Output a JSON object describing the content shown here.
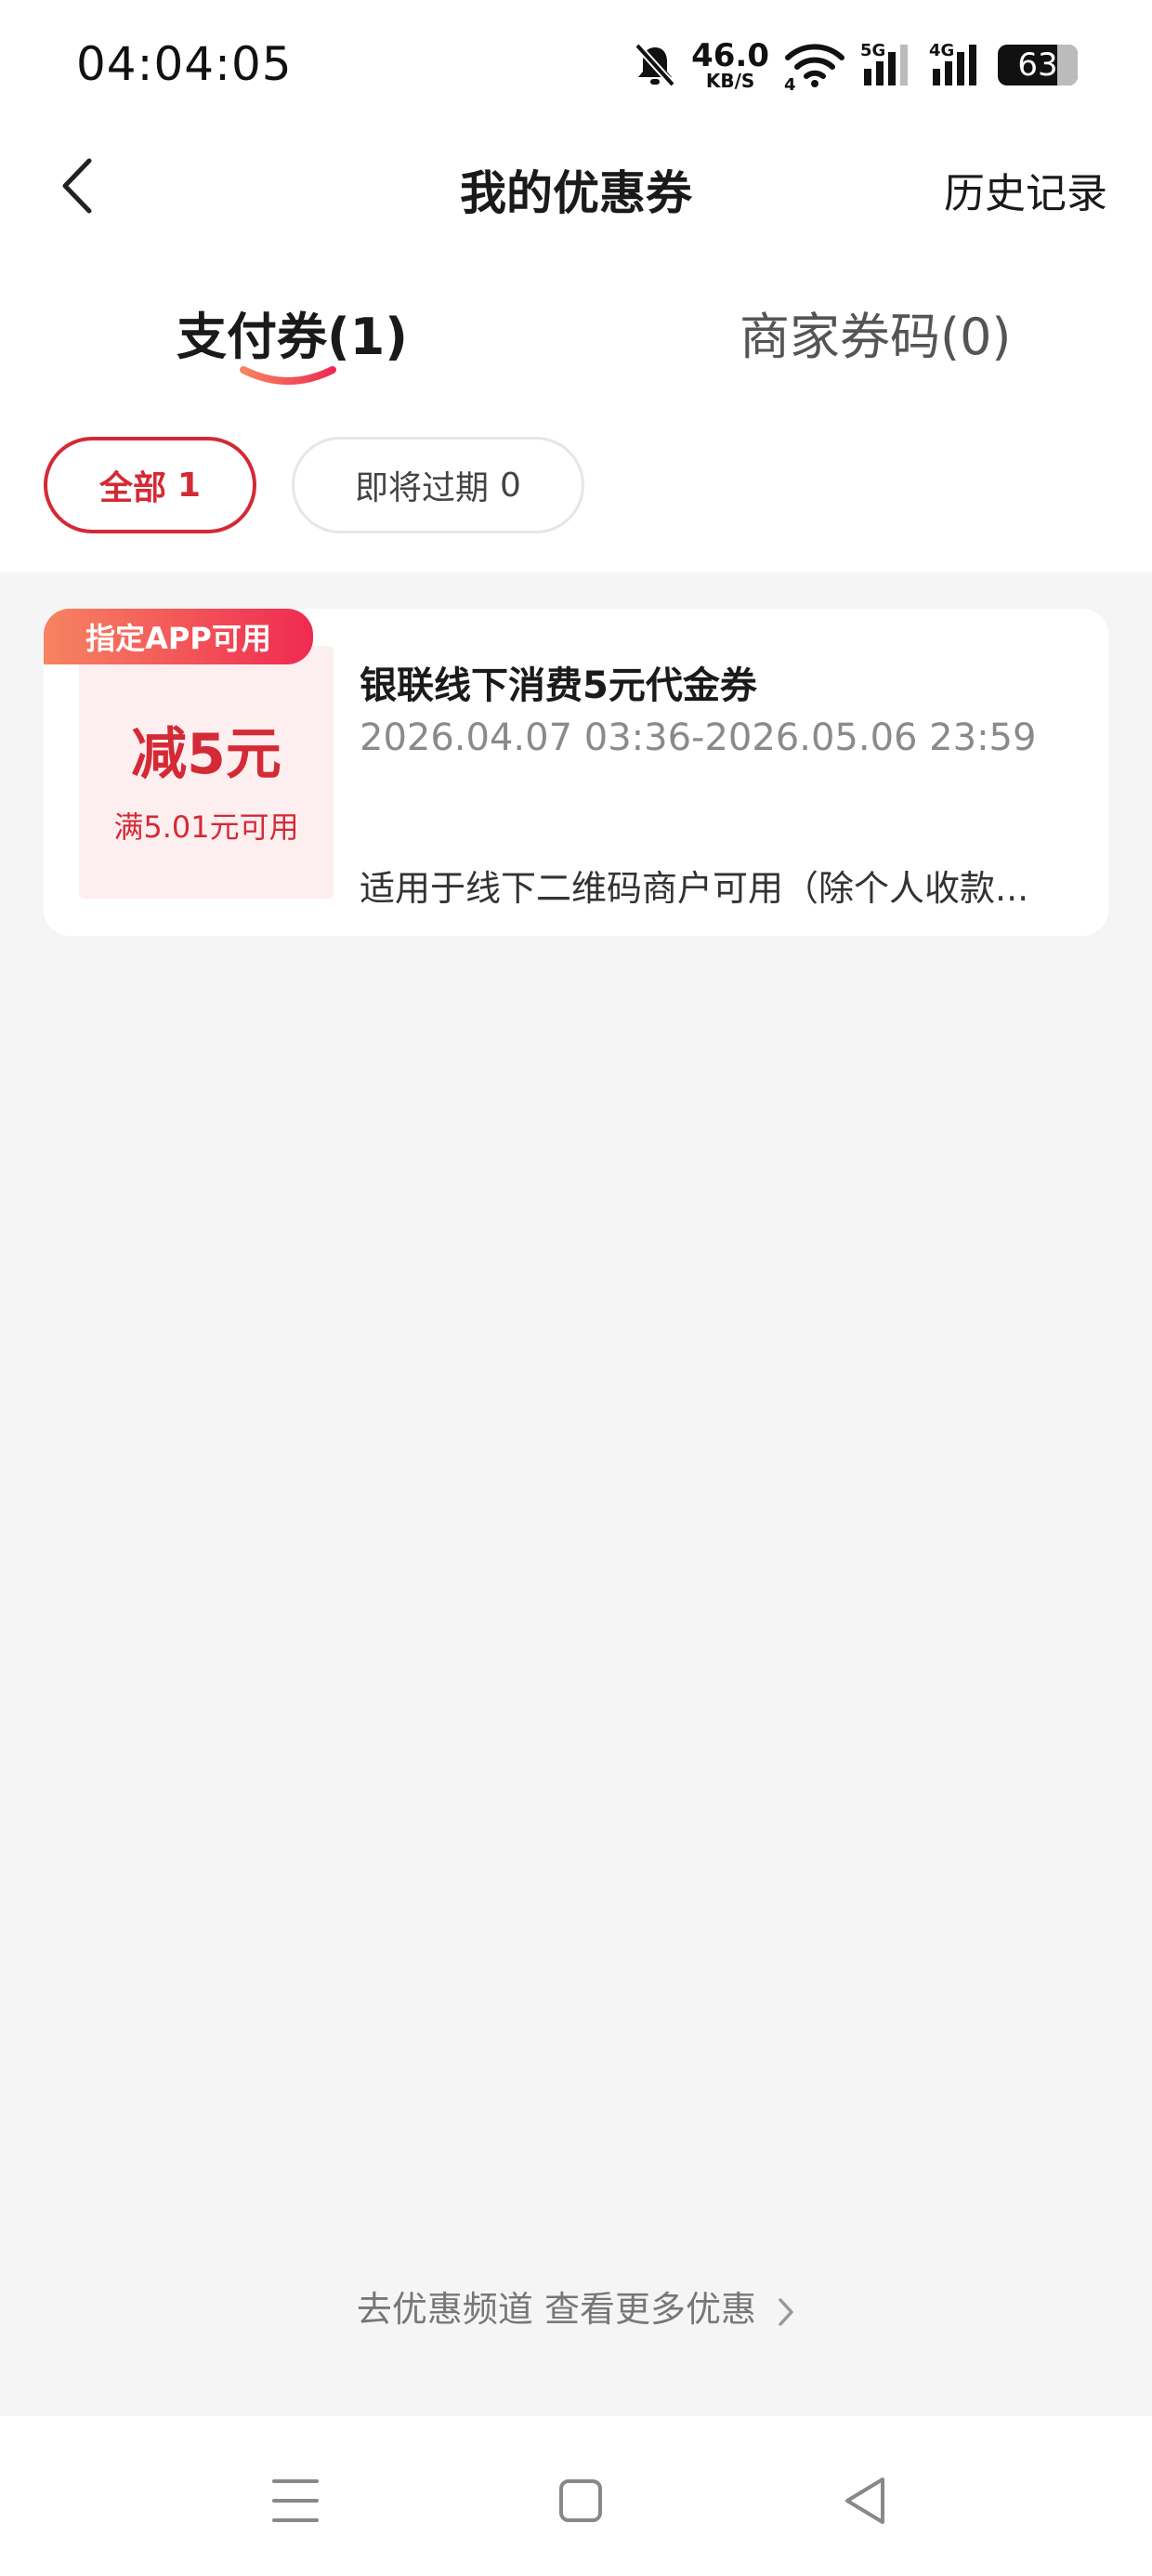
{
  "status_bar": {
    "time": "04:04:05",
    "net_speed_value": "46.0",
    "net_speed_unit": "KB/S",
    "wifi_sub": "4",
    "signal_1_label": "5G",
    "signal_2_label": "4G",
    "battery": "63",
    "icons": [
      "mute-bell-icon",
      "wifi-icon",
      "signal-5g-icon",
      "signal-4g-icon",
      "battery-icon"
    ]
  },
  "header": {
    "title": "我的优惠券",
    "history_label": "历史记录",
    "back_icon": "chevron-left-icon"
  },
  "tabs": [
    {
      "label": "支付券(1)",
      "active": true
    },
    {
      "label": "商家券码(0)",
      "active": false
    }
  ],
  "filters": [
    {
      "label": "全部",
      "count": "1",
      "active": true
    },
    {
      "label": "即将过期",
      "count": "0",
      "active": false
    }
  ],
  "coupons": [
    {
      "tag": "指定APP可用",
      "amount": "减5元",
      "condition": "满5.01元可用",
      "name": "银联线下消费5元代金券",
      "validity": "2026.04.07 03:36-2026.05.06 23:59",
      "description": "适用于线下二维码商户可用（除个人收款..."
    }
  ],
  "footer_link": {
    "label": "去优惠频道 查看更多优惠",
    "icon": "chevron-right-icon"
  },
  "system_nav": {
    "icons": [
      "menu-icon",
      "home-icon",
      "back-triangle-icon"
    ]
  },
  "colors": {
    "accent": "#d42a35",
    "tag_gradient_start": "#f78461",
    "tag_gradient_end": "#ef2a51",
    "page_bg": "#f5f5f5",
    "coupon_bg": "#fdeef0"
  }
}
